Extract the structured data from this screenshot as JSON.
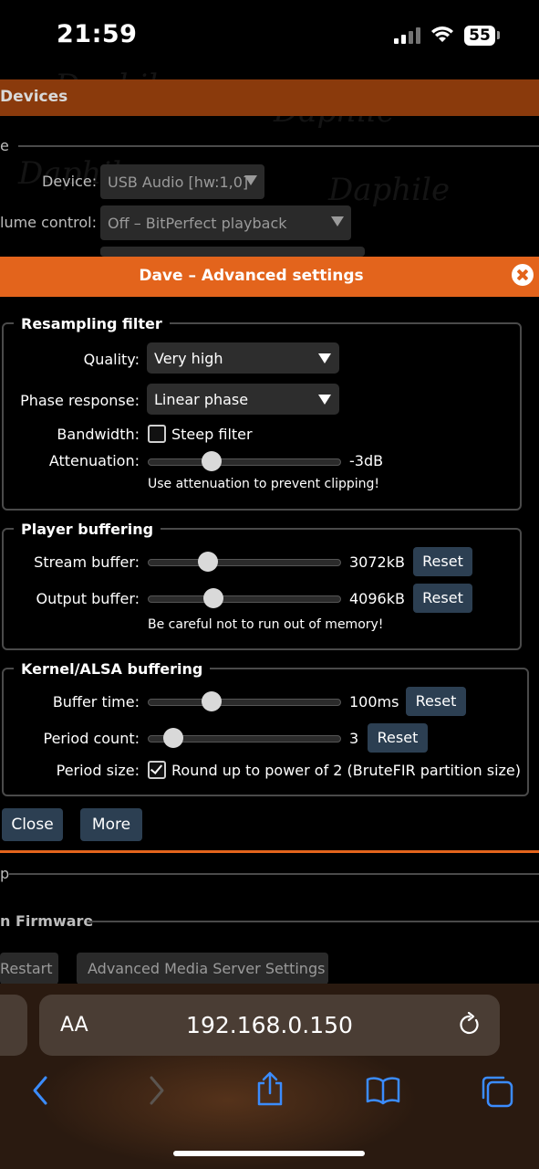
{
  "status": {
    "time": "21:59",
    "battery": "55"
  },
  "background": {
    "section_title": "Devices",
    "sub_label": "e",
    "device_label": "Device:",
    "device_value": "USB Audio [hw:1,0]",
    "volume_label": "lume control:",
    "volume_value": "Off – BitPerfect playback",
    "row_p": "p",
    "firmware_label": "n Firmware",
    "restart_label": "Restart",
    "adv_media_label": "Advanced Media Server Settings",
    "watermark": "Daphile"
  },
  "dialog": {
    "title": "Dave – Advanced settings",
    "resampling": {
      "legend": "Resampling filter",
      "quality_label": "Quality:",
      "quality_value": "Very high",
      "phase_label": "Phase response:",
      "phase_value": "Linear phase",
      "bandwidth_label": "Bandwidth:",
      "bandwidth_option": "Steep filter",
      "bandwidth_checked": false,
      "attenuation_label": "Attenuation:",
      "attenuation_value": "-3dB",
      "attenuation_level": 0.28,
      "note": "Use attenuation to prevent clipping!"
    },
    "player_buffering": {
      "legend": "Player buffering",
      "stream_label": "Stream buffer:",
      "stream_value": "3072kB",
      "stream_level": 0.26,
      "output_label": "Output buffer:",
      "output_value": "4096kB",
      "output_level": 0.29,
      "reset": "Reset",
      "note": "Be careful not to run out of memory!"
    },
    "kernel_buffering": {
      "legend": "Kernel/ALSA buffering",
      "buffer_time_label": "Buffer time:",
      "buffer_time_value": "100ms",
      "buffer_time_level": 0.28,
      "period_count_label": "Period count:",
      "period_count_value": "3",
      "period_count_level": 0.08,
      "period_size_label": "Period size:",
      "period_size_option": "Round up to power of 2 (BruteFIR partition size)",
      "period_size_checked": true,
      "reset": "Reset"
    },
    "close_label": "Close",
    "more_label": "More"
  },
  "safari": {
    "text_size": "AA",
    "url": "192.168.0.150"
  }
}
